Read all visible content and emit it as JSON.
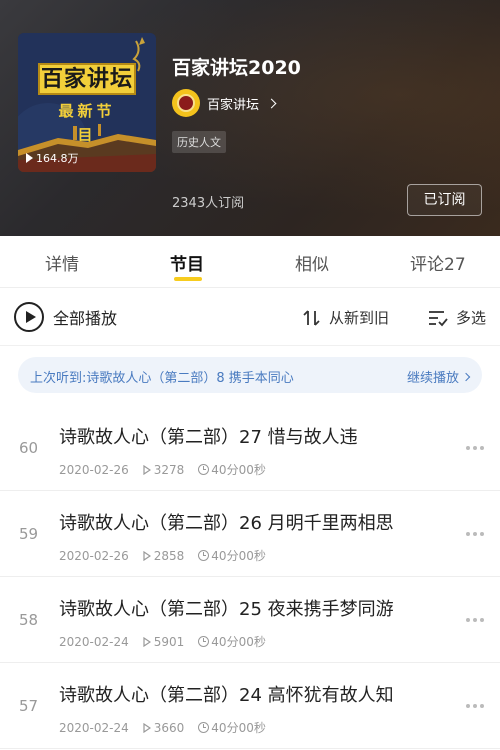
{
  "header": {
    "cover": {
      "title": "百家讲坛",
      "subtitle": "最新节目",
      "play_count": "164.8万"
    },
    "album_title": "百家讲坛2020",
    "author": "百家讲坛",
    "tag": "历史人文",
    "subscribers": "2343人订阅",
    "subscribe_button": "已订阅"
  },
  "tabs": [
    {
      "label": "详情"
    },
    {
      "label": "节目"
    },
    {
      "label": "相似"
    },
    {
      "label": "评论27"
    }
  ],
  "toolbar": {
    "play_all": "全部播放",
    "sort": "从新到旧",
    "multi_select": "多选"
  },
  "history": {
    "text": "上次听到:诗歌故人心（第二部）8 携手本同心",
    "continue": "继续播放"
  },
  "episodes": [
    {
      "number": "60",
      "title": "诗歌故人心（第二部）27 惜与故人违",
      "date": "2020-02-26",
      "plays": "3278",
      "duration": "40分00秒"
    },
    {
      "number": "59",
      "title": "诗歌故人心（第二部）26 月明千里两相思",
      "date": "2020-02-26",
      "plays": "2858",
      "duration": "40分00秒"
    },
    {
      "number": "58",
      "title": "诗歌故人心（第二部）25 夜来携手梦同游",
      "date": "2020-02-24",
      "plays": "5901",
      "duration": "40分00秒"
    },
    {
      "number": "57",
      "title": "诗歌故人心（第二部）24 高怀犹有故人知",
      "date": "2020-02-24",
      "plays": "3660",
      "duration": "40分00秒"
    }
  ],
  "colors": {
    "accent_yellow": "#f7cc1e",
    "history_blue": "#4a7bc0",
    "header_dark": "#2b2a2d"
  }
}
